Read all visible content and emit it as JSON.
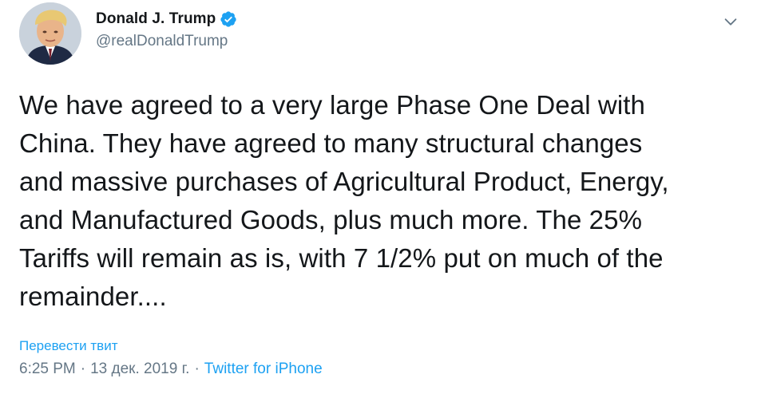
{
  "author": {
    "display_name": "Donald J. Trump",
    "handle": "@realDonaldTrump",
    "verified": true,
    "avatar_icon": "profile-avatar"
  },
  "tweet": {
    "text": "We have agreed to a very large Phase One Deal with\nChina. They have agreed to many structural changes\nand massive purchases of Agricultural Product, Energy,\nand Manufactured Goods, plus much more. The 25%\nTariffs will remain as is, with 7 1/2% put on much of the\nremainder....",
    "translate_label": "Перевести твит",
    "time": "6:25 PM",
    "separator": "·",
    "date": "13 дек. 2019 г.",
    "separator2": "·",
    "source": "Twitter for iPhone"
  },
  "icons": {
    "verified": "verified-badge-icon",
    "menu": "chevron-down-icon"
  },
  "colors": {
    "accent": "#1da1f2",
    "text": "#14171a",
    "secondary": "#657786"
  }
}
